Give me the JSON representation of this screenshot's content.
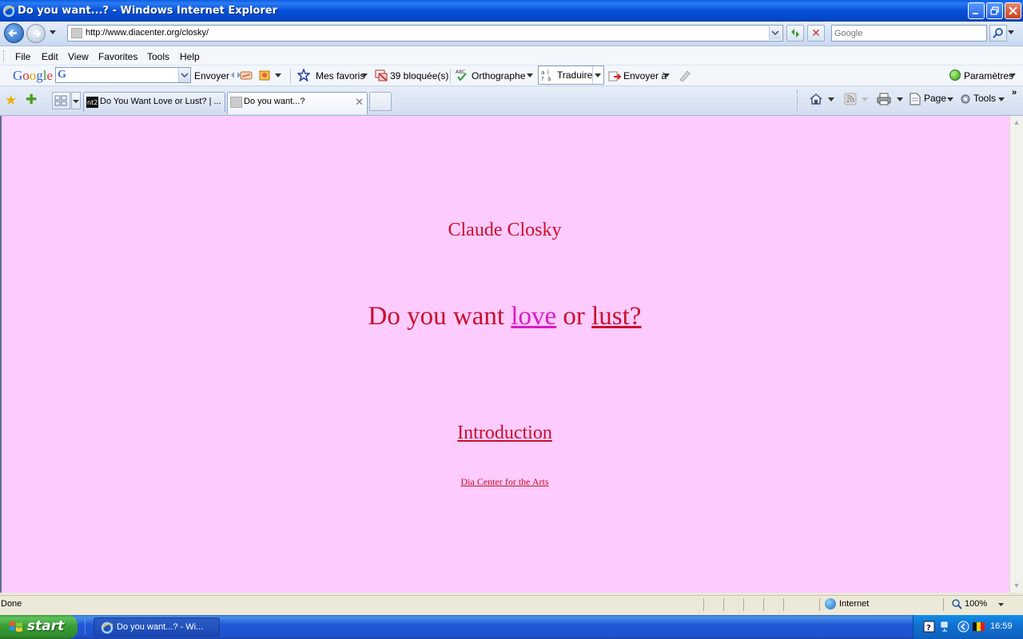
{
  "window": {
    "title": "Do you want...? - Windows Internet Explorer"
  },
  "address_bar": {
    "url": "http://www.diacenter.org/closky/"
  },
  "search": {
    "placeholder": "Google"
  },
  "menu": {
    "items": [
      "File",
      "Edit",
      "View",
      "Favorites",
      "Tools",
      "Help"
    ]
  },
  "google_toolbar": {
    "logo": "Google",
    "send_label": "Envoyer",
    "favorites_label": "Mes favoris",
    "blocked_label": "39 bloquée(s)",
    "spelling_label": "Orthographe",
    "translate_label": "Traduire",
    "send_to_label": "Envoyer à",
    "settings_label": "Paramètres"
  },
  "tabs": [
    {
      "label": "Do You Want Love or Lust? | ...",
      "favicon_text": "nt2",
      "active": false
    },
    {
      "label": "Do you want...?",
      "active": true
    }
  ],
  "command_bar": {
    "page_label": "Page",
    "tools_label": "Tools"
  },
  "page": {
    "artist": "Claude Closky",
    "headline_prefix": "Do you want",
    "link_love": "love",
    "headline_or": "or",
    "link_lust": "lust?",
    "intro_link": "Introduction",
    "dia_link": "Dia Center for the Arts",
    "background_color": "#fecbfe",
    "text_color": "#c8102e",
    "visited_link_color": "#d91cc4"
  },
  "status_bar": {
    "status": "Done",
    "zone": "Internet",
    "zoom": "100%"
  },
  "taskbar": {
    "start_label": "start",
    "task_label": "Do you want...? - Wi...",
    "time": "16:59"
  }
}
